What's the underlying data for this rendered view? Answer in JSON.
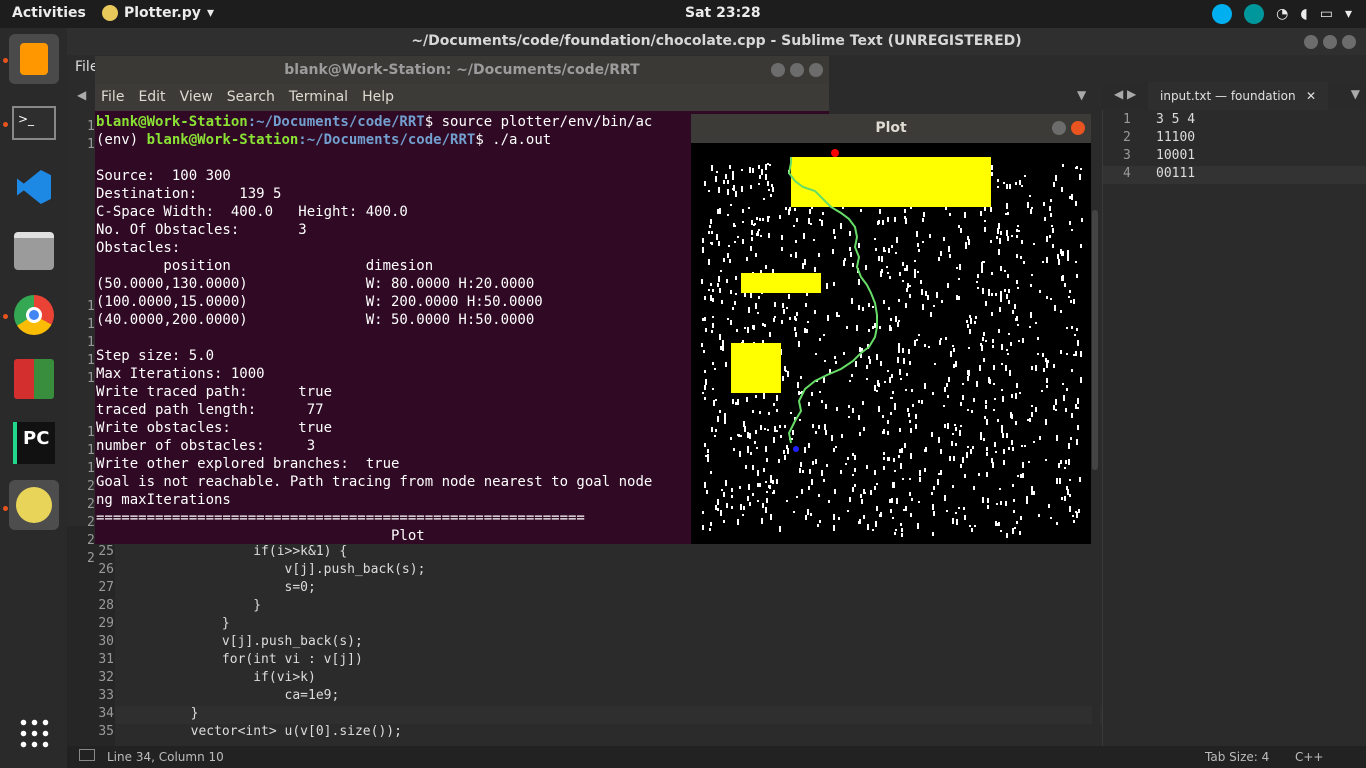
{
  "topbar": {
    "activities": "Activities",
    "app": "Plotter.py",
    "clock": "Sat 23:28"
  },
  "sublime": {
    "title": "~/Documents/code/foundation/chocolate.cpp - Sublime Text (UNREGISTERED)",
    "file_menu": "File",
    "right_tab": "input.txt — foundation",
    "right_lines": [
      {
        "n": "1",
        "t": "3 5 4"
      },
      {
        "n": "2",
        "t": "11100"
      },
      {
        "n": "3",
        "t": "10001"
      },
      {
        "n": "4",
        "t": "00111"
      }
    ],
    "code_lines": [
      {
        "n": "24",
        "t": ""
      },
      {
        "n": "25",
        "t": "                if(i>>k&1) {"
      },
      {
        "n": "26",
        "t": "                    v[j].push_back(s);"
      },
      {
        "n": "27",
        "t": "                    s=0;"
      },
      {
        "n": "28",
        "t": "                }"
      },
      {
        "n": "29",
        "t": "            }"
      },
      {
        "n": "30",
        "t": "            v[j].push_back(s);"
      },
      {
        "n": "31",
        "t": "            for(int vi : v[j])"
      },
      {
        "n": "32",
        "t": "                if(vi>k)"
      },
      {
        "n": "33",
        "t": "                    ca=1e9;"
      },
      {
        "n": "34",
        "t": "        }"
      },
      {
        "n": "35",
        "t": "        vector<int> u(v[0].size());"
      }
    ],
    "status_left": "Line 34, Column 10",
    "status_tab": "Tab Size: 4",
    "status_lang": "C++"
  },
  "terminal": {
    "title": "blank@Work-Station: ~/Documents/code/RRT",
    "menu": [
      "File",
      "Edit",
      "View",
      "Search",
      "Terminal",
      "Help"
    ],
    "prompt1_user": "blank@Work-Station",
    "prompt1_path": ":~/Documents/code/RRT",
    "prompt1_cmd": "$ source plotter/env/bin/ac",
    "prompt2_env": "(env) ",
    "prompt2_user": "blank@Work-Station",
    "prompt2_path": ":~/Documents/code/RRT",
    "prompt2_cmd": "$ ./a.out",
    "lines": [
      "",
      "Source:  100 300",
      "Destination:     139 5",
      "C-Space Width:  400.0   Height: 400.0",
      "No. Of Obstacles:       3",
      "Obstacles:",
      "        position                dimesion",
      "(50.0000,130.0000)              W: 80.0000 H:20.0000",
      "(100.0000,15.0000)              W: 200.0000 H:50.0000",
      "(40.0000,200.0000)              W: 50.0000 H:50.0000",
      "",
      "Step size: 5.0",
      "Max Iterations: 1000",
      "Write traced path:      true",
      "traced path length:      77",
      "Write obstacles:        true",
      "number of obstacles:     3",
      "Write other explored branches:  true",
      "Goal is not reachable. Path tracing from node nearest to goal node",
      "ng maxIterations",
      "==========================================================",
      "                                   Plot"
    ],
    "gutter_nums": [
      "1",
      "1",
      "",
      "",
      "",
      "",
      "",
      "",
      "",
      "",
      "1",
      "1",
      "1",
      "1",
      "1",
      "",
      "",
      "1",
      "1",
      "1",
      "2",
      "2",
      "2",
      "2",
      "2"
    ]
  },
  "plot": {
    "title": "Plot"
  }
}
